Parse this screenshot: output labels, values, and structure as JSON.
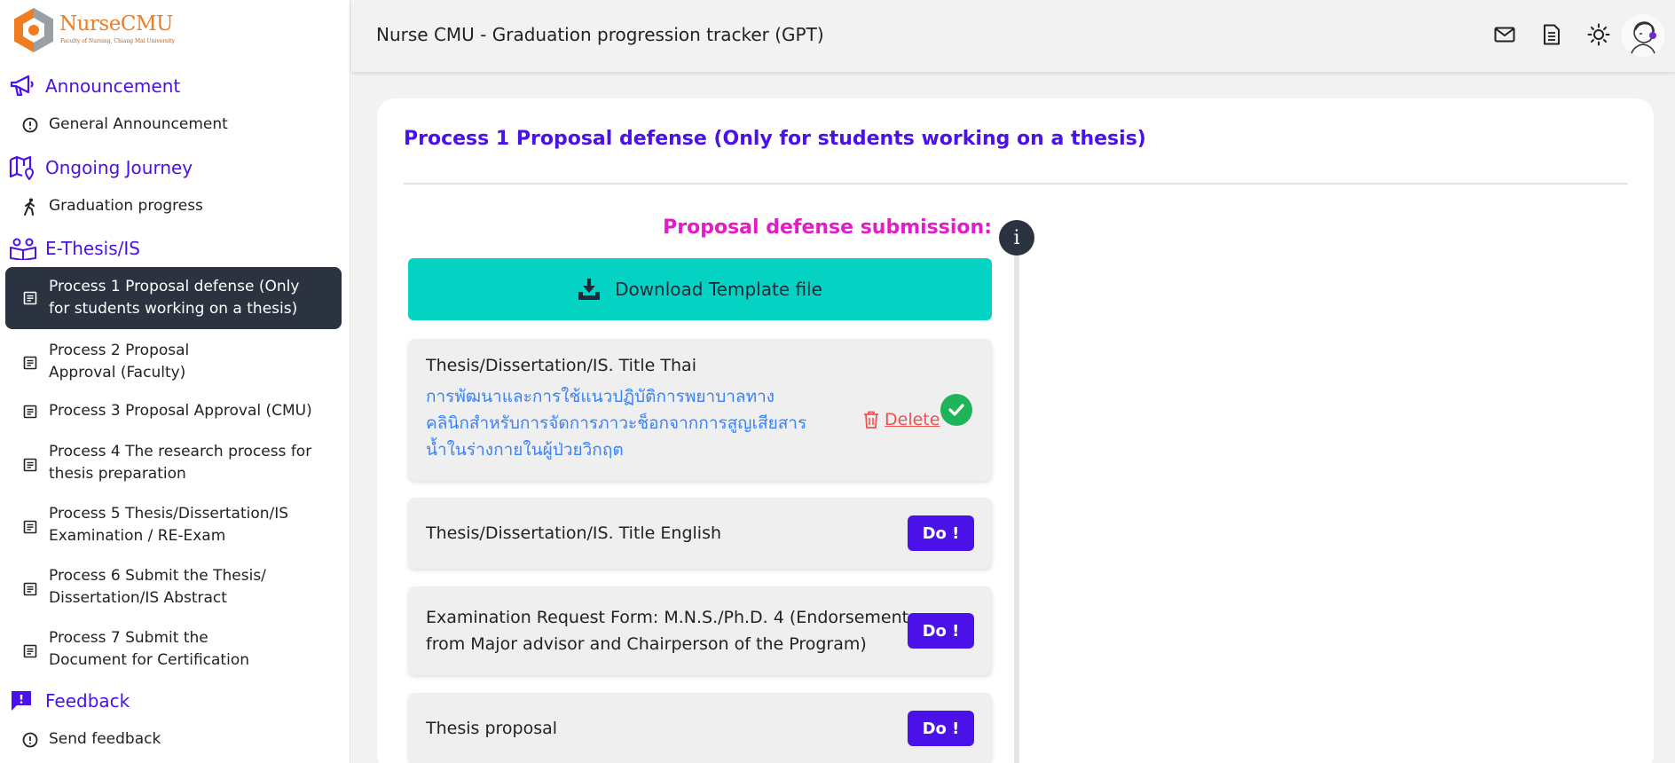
{
  "logo": {
    "name": "NurseCMU",
    "subtitle": "Faculty of Nursing, Chiang Mai University"
  },
  "header": {
    "title": "Nurse CMU - Graduation progression tracker (GPT)"
  },
  "sidebar": {
    "sections": [
      {
        "title": "Announcement",
        "icon": "megaphone-icon",
        "items": [
          {
            "label": "General Announcement",
            "icon": "alert-circle-icon"
          }
        ]
      },
      {
        "title": "Ongoing Journey",
        "icon": "map-icon",
        "items": [
          {
            "label": "Graduation progress",
            "icon": "walking-icon"
          }
        ]
      },
      {
        "title": "E-Thesis/IS",
        "icon": "book-reader-icon",
        "items": [
          {
            "label": "Process 1 Proposal defense (Only for students working on a thesis)",
            "icon": "document-icon",
            "active": true
          },
          {
            "label": "Process 2 Proposal Approval (Faculty)",
            "icon": "document-icon"
          },
          {
            "label": "Process 3 Proposal Approval (CMU)",
            "icon": "document-icon"
          },
          {
            "label": "Process 4 The research process for thesis preparation",
            "icon": "document-icon"
          },
          {
            "label": "Process 5 Thesis/Dissertation/IS Examination / RE-Exam",
            "icon": "document-icon"
          },
          {
            "label": "Process 6 Submit the Thesis/ Dissertation/IS Abstract",
            "icon": "document-icon"
          },
          {
            "label": "Process 7 Submit the Document for Certification",
            "icon": "document-icon"
          }
        ]
      },
      {
        "title": "Feedback",
        "icon": "feedback-icon",
        "items": [
          {
            "label": "Send feedback",
            "icon": "alert-circle-icon"
          }
        ]
      }
    ]
  },
  "main": {
    "title": "Process 1 Proposal defense (Only for students working on a thesis)",
    "submission_label": "Proposal defense submission:",
    "info_glyph": "i",
    "download_label": "Download Template file",
    "steps": [
      {
        "label": "Thesis/Dissertation/IS. Title Thai",
        "value": "การพัฒนาและการใช้แนวปฏิบัติการพยาบาลทางคลินิกสำหรับการจัดการภาวะช็อกจากการสูญเสียสารน้ำในร่างกายในผู้ป่วยวิกฤต",
        "delete_label": "Delete",
        "status": "completed"
      },
      {
        "label": "Thesis/Dissertation/IS. Title English",
        "action_label": "Do !"
      },
      {
        "label": "Examination Request Form: M.N.S./Ph.D. 4 (Endorsement from Major advisor and Chairperson of the Program)",
        "action_label": "Do !"
      },
      {
        "label": "Thesis proposal",
        "action_label": "Do !"
      }
    ]
  },
  "colors": {
    "primary": "#4a12e8",
    "accent_teal": "#04d3c4",
    "magenta": "#e41bc8",
    "danger": "#f05252",
    "success": "#20b45a",
    "dark": "#2b3240"
  }
}
